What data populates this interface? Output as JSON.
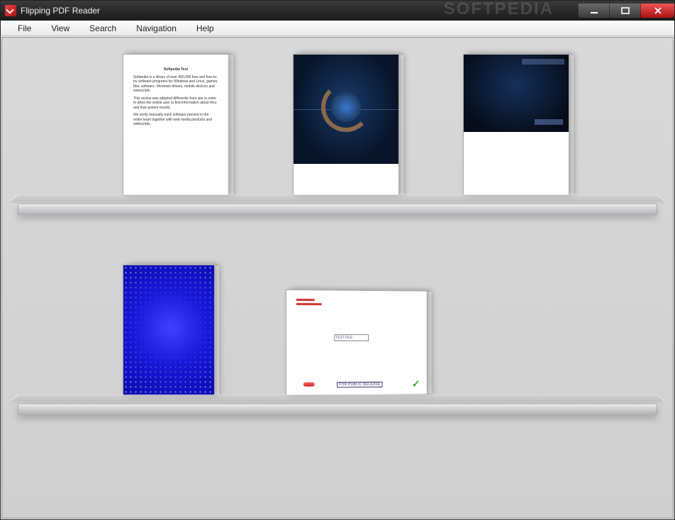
{
  "window": {
    "title": "Flipping PDF Reader",
    "watermark": "SOFTPEDIA"
  },
  "menu": {
    "file": "File",
    "view": "View",
    "search": "Search",
    "navigation": "Navigation",
    "help": "Help"
  },
  "shelves": [
    {
      "thumbs": [
        {
          "kind": "text_doc",
          "title": "Softpedia Test",
          "p1": "Softpedia is a library of over 400,000 free and free-to-try software programs for Windows and Linux, games, Mac software, Windows drivers, mobile devices and webscripts.",
          "p2": "This review was adopted differently from site in order to allow the visible user to find information about they and that system results.",
          "p3": "We verify manually each software present in the entire team together with web media products and webscripts."
        },
        {
          "kind": "dark_logo"
        },
        {
          "kind": "dark_banner"
        }
      ]
    },
    {
      "thumbs": [
        {
          "kind": "blue_pattern"
        },
        {
          "kind": "release_card",
          "box_text": "TEST FILE",
          "stamp": "FOR PUBLIC RELEASE"
        }
      ]
    }
  ]
}
